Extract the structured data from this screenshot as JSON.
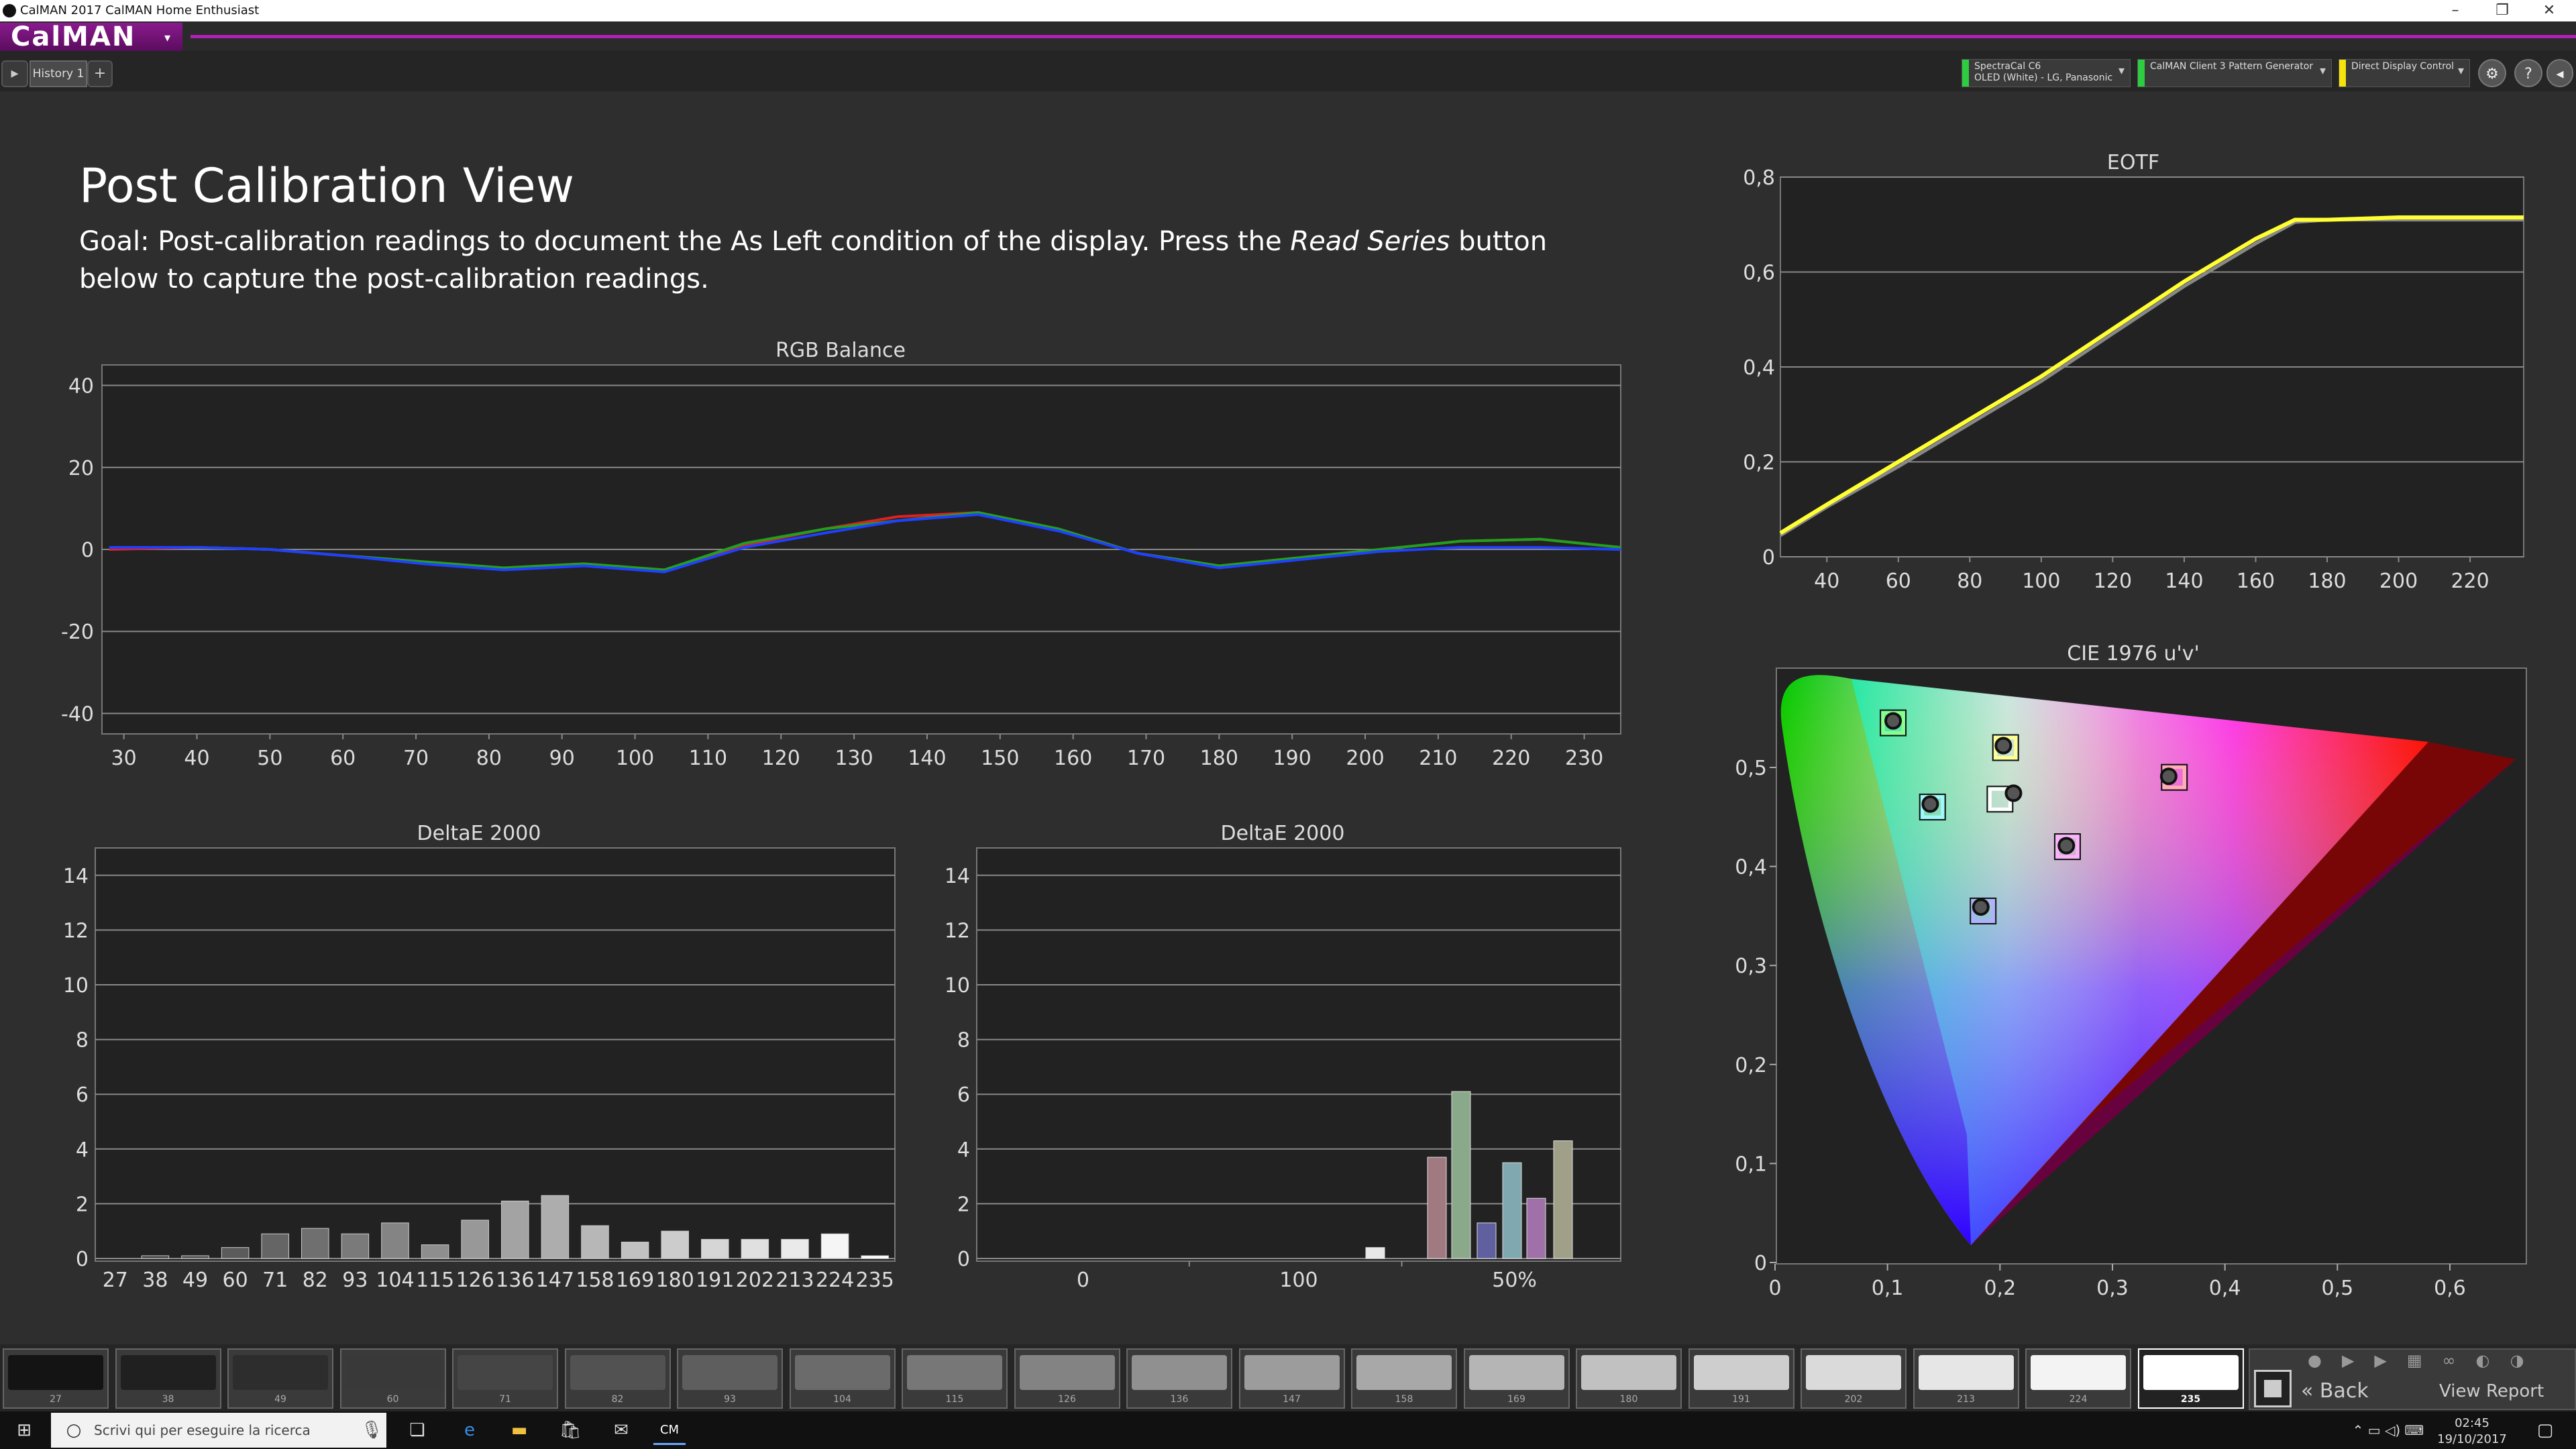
{
  "window": {
    "title": "CalMAN 2017 CalMAN Home Enthusiast",
    "controls": [
      "–",
      "❐",
      "✕"
    ]
  },
  "app": {
    "logo": "CalMAN",
    "logo_dropdown": "▾"
  },
  "tabs": {
    "history": "History 1",
    "add": "+"
  },
  "devices": [
    {
      "line1": "SpectraCal C6",
      "line2": "OLED (White) - LG, Panasonic",
      "color": "#2ecc40"
    },
    {
      "line1": "CalMAN Client 3 Pattern Generator",
      "line2": "",
      "color": "#2ecc40"
    },
    {
      "line1": "Direct Display Control",
      "line2": "",
      "color": "#f5e30c"
    }
  ],
  "main": {
    "title": "Post Calibration View",
    "goal_prefix": "Goal: Post-calibration readings to document the As Left condition of the display. Press the ",
    "goal_em": "Read Series",
    "goal_suffix": " button below to capture the post-calibration readings."
  },
  "rgb_chart": {
    "title": "RGB Balance",
    "yticks": [
      "40",
      "20",
      "0",
      "-20",
      "-40"
    ],
    "xticks": [
      "30",
      "40",
      "50",
      "60",
      "70",
      "80",
      "90",
      "100",
      "110",
      "120",
      "130",
      "140",
      "150",
      "160",
      "170",
      "180",
      "190",
      "200",
      "210",
      "220",
      "230"
    ]
  },
  "eotf_chart": {
    "title": "EOTF",
    "yticks": [
      "0,8",
      "0,6",
      "0,4",
      "0,2",
      "0"
    ],
    "xticks": [
      "40",
      "60",
      "80",
      "100",
      "120",
      "140",
      "160",
      "180",
      "200",
      "220"
    ]
  },
  "deltae_gray": {
    "title": "DeltaE 2000",
    "yticks": [
      "14",
      "12",
      "10",
      "8",
      "6",
      "4",
      "2",
      "0"
    ],
    "labels": [
      "27",
      "38",
      "49",
      "60",
      "71",
      "82",
      "93",
      "104",
      "115",
      "126",
      "136",
      "147",
      "158",
      "169",
      "180",
      "191",
      "202",
      "213",
      "224",
      "235"
    ]
  },
  "deltae_color": {
    "title": "DeltaE 2000",
    "yticks": [
      "14",
      "12",
      "10",
      "8",
      "6",
      "4",
      "2",
      "0"
    ],
    "xticks": [
      "0",
      "100",
      "50%"
    ]
  },
  "cie_chart": {
    "title": "CIE 1976 u'v'",
    "yticks": [
      "0,5",
      "0,4",
      "0,3",
      "0,2",
      "0,1",
      "0"
    ],
    "xticks": [
      "0",
      "0,1",
      "0,2",
      "0,3",
      "0,4",
      "0,5",
      "0,6"
    ]
  },
  "chart_data": [
    {
      "type": "line",
      "title": "RGB Balance",
      "xlabel": "",
      "ylabel": "",
      "x": [
        28,
        40,
        50,
        60,
        71,
        82,
        93,
        104,
        115,
        126,
        136,
        147,
        158,
        169,
        180,
        191,
        202,
        213,
        224,
        235
      ],
      "ylim": [
        -45,
        45
      ],
      "xlim": [
        27,
        235
      ],
      "grid": true,
      "series": [
        {
          "color": "#e02020",
          "values": [
            0,
            0.5,
            0,
            -1.5,
            -3,
            -4.5,
            -3.5,
            -5,
            1,
            5,
            8,
            9,
            5,
            -1,
            -4,
            -2,
            0,
            2,
            2.5,
            0.5
          ]
        },
        {
          "color": "#20a020",
          "values": [
            0.5,
            0.5,
            0,
            -1.5,
            -3,
            -4.5,
            -3.5,
            -5,
            1.5,
            5,
            7,
            9,
            5,
            -1,
            -4,
            -2,
            0,
            2,
            2.5,
            0.5
          ]
        },
        {
          "color": "#2040ff",
          "values": [
            0.5,
            0.5,
            0,
            -1.5,
            -3.5,
            -5,
            -4,
            -5.5,
            0.5,
            4,
            7,
            8.5,
            4.5,
            -1,
            -4.5,
            -2.5,
            -0.5,
            0.5,
            0.5,
            0
          ]
        }
      ]
    },
    {
      "type": "line",
      "title": "EOTF",
      "x": [
        27,
        40,
        60,
        80,
        100,
        120,
        140,
        160,
        171,
        180,
        200,
        220,
        235
      ],
      "xlim": [
        27,
        235
      ],
      "ylim": [
        0,
        0.8
      ],
      "grid": true,
      "series": [
        {
          "color": "#ffff33",
          "values": [
            0.05,
            0.11,
            0.2,
            0.29,
            0.38,
            0.48,
            0.58,
            0.67,
            0.71,
            0.71,
            0.715,
            0.715,
            0.715
          ]
        },
        {
          "color": "#888888",
          "values": [
            0.045,
            0.105,
            0.19,
            0.28,
            0.37,
            0.47,
            0.57,
            0.66,
            0.705,
            0.71,
            0.71,
            0.71,
            0.71
          ]
        }
      ]
    },
    {
      "type": "bar",
      "title": "DeltaE 2000",
      "categories": [
        "27",
        "38",
        "49",
        "60",
        "71",
        "82",
        "93",
        "104",
        "115",
        "126",
        "136",
        "147",
        "158",
        "169",
        "180",
        "191",
        "202",
        "213",
        "224",
        "235"
      ],
      "values": [
        0,
        0.1,
        0.1,
        0.4,
        0.9,
        1.1,
        0.9,
        1.3,
        0.5,
        1.4,
        2.1,
        2.3,
        1.2,
        0.6,
        1.0,
        0.7,
        0.7,
        0.7,
        0.9,
        0.1
      ],
      "ylim": [
        0,
        15
      ],
      "grid": true
    },
    {
      "type": "bar",
      "title": "DeltaE 2000",
      "values": [
        0.4,
        3.7,
        6.1,
        1.3,
        3.5,
        2.2,
        4.3
      ],
      "colors": [
        "#e8e8e8",
        "#a07a80",
        "#8aa88a",
        "#6060a0",
        "#80a8b0",
        "#a070a8",
        "#a0a088"
      ],
      "ylim": [
        0,
        15
      ],
      "grid": true
    },
    {
      "type": "scatter",
      "title": "CIE 1976 u'v'",
      "xlim": [
        0,
        0.63
      ],
      "ylim": [
        0,
        0.6
      ],
      "targets": [
        {
          "u": 0.105,
          "v": 0.545,
          "color": "#88ff88"
        },
        {
          "u": 0.14,
          "v": 0.46,
          "color": "#a0f8ff"
        },
        {
          "u": 0.205,
          "v": 0.52,
          "color": "#ffff90"
        },
        {
          "u": 0.2,
          "v": 0.468,
          "color": "#ffffff"
        },
        {
          "u": 0.26,
          "v": 0.42,
          "color": "#ffb0ff"
        },
        {
          "u": 0.355,
          "v": 0.49,
          "color": "#ffb0b0"
        },
        {
          "u": 0.185,
          "v": 0.355,
          "color": "#b0b0ff"
        }
      ],
      "measured": [
        {
          "u": 0.105,
          "v": 0.547
        },
        {
          "u": 0.138,
          "v": 0.463
        },
        {
          "u": 0.203,
          "v": 0.522
        },
        {
          "u": 0.212,
          "v": 0.474
        },
        {
          "u": 0.259,
          "v": 0.421
        },
        {
          "u": 0.35,
          "v": 0.491
        },
        {
          "u": 0.183,
          "v": 0.359
        }
      ]
    }
  ],
  "swatches": [
    "27",
    "38",
    "49",
    "60",
    "71",
    "82",
    "93",
    "104",
    "115",
    "126",
    "136",
    "147",
    "158",
    "169",
    "180",
    "191",
    "202",
    "213",
    "224",
    "235"
  ],
  "nav": {
    "back": "Back",
    "view_report": "View Report"
  },
  "taskbar": {
    "search_placeholder": "Scrivi qui per eseguire la ricerca",
    "time": "02:45",
    "date": "19/10/2017"
  }
}
